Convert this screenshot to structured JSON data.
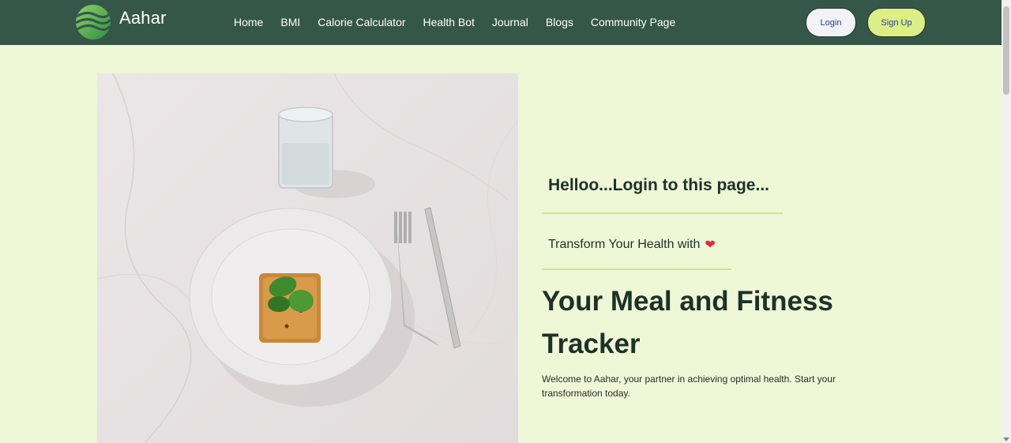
{
  "brand": {
    "name": "Aahar",
    "logo_icon": "leaf-wave-logo-icon"
  },
  "nav": {
    "links": [
      {
        "label": "Home"
      },
      {
        "label": "BMI"
      },
      {
        "label": "Calorie Calculator"
      },
      {
        "label": "Health Bot"
      },
      {
        "label": "Journal"
      },
      {
        "label": "Blogs"
      },
      {
        "label": "Community Page"
      }
    ],
    "login_label": "Login",
    "signup_label": "Sign Up"
  },
  "hero": {
    "image_icon": "plate-with-food-photo",
    "greeting": "Helloo...Login to this page...",
    "subtitle": "Transform Your Health with",
    "subtitle_icon": "heart-icon",
    "headline": "Your Meal and Fitness Tracker",
    "description": "Welcome to Aahar, your partner in achieving optimal health. Start your transformation today."
  },
  "colors": {
    "navbar": "#35574a",
    "page_bg": "#eef7d6",
    "accent": "#dcef86",
    "text_dark": "#1e3128"
  }
}
